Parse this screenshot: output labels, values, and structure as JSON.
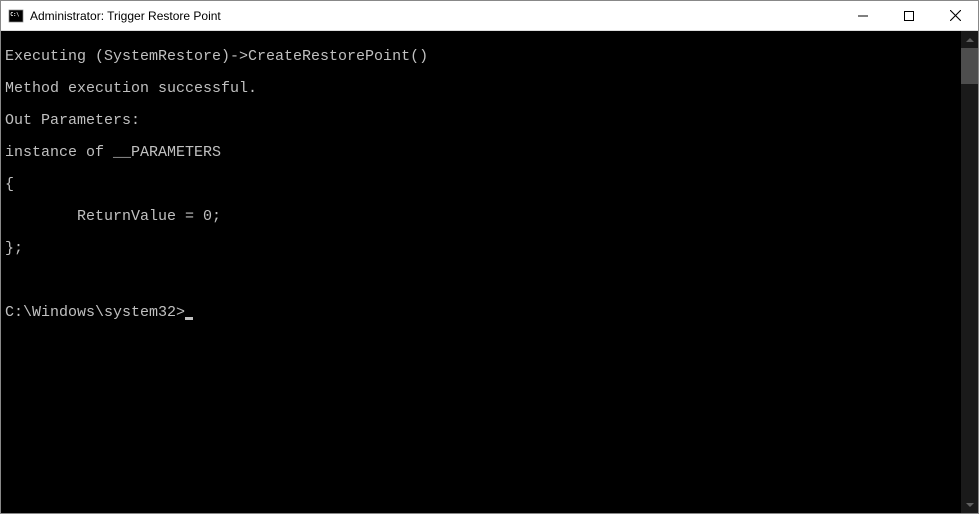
{
  "window": {
    "title": "Administrator: Trigger Restore Point"
  },
  "console": {
    "lines": [
      "Executing (SystemRestore)->CreateRestorePoint()",
      "Method execution successful.",
      "Out Parameters:",
      "instance of __PARAMETERS",
      "{",
      "        ReturnValue = 0;",
      "};",
      "",
      ""
    ],
    "prompt": "C:\\Windows\\system32>"
  }
}
